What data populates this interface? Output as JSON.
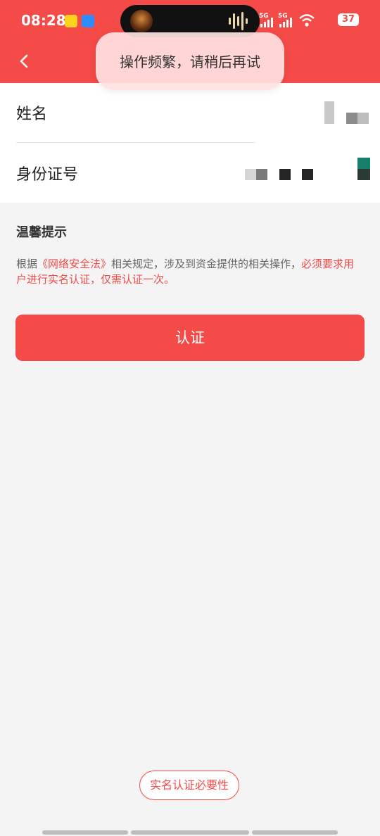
{
  "status_bar": {
    "time": "08:28",
    "signal1": "5G",
    "signal2": "5G",
    "battery": "37"
  },
  "toast": {
    "message": "操作频繁，请稍后再试"
  },
  "form": {
    "name_label": "姓名",
    "id_label": "身份证号"
  },
  "tips": {
    "title": "温馨提示",
    "text_prefix": "根据",
    "law": "《网络安全法》",
    "text_middle": "相关规定，涉及到资金提供的相关操作，",
    "text_highlight": "必须要求用户进行实名认证，仅需认证一次。"
  },
  "verify_button": "认证",
  "necessity_button": "实名认证必要性",
  "colors": {
    "brand": "#f44a48",
    "background": "#f4f4f4"
  }
}
